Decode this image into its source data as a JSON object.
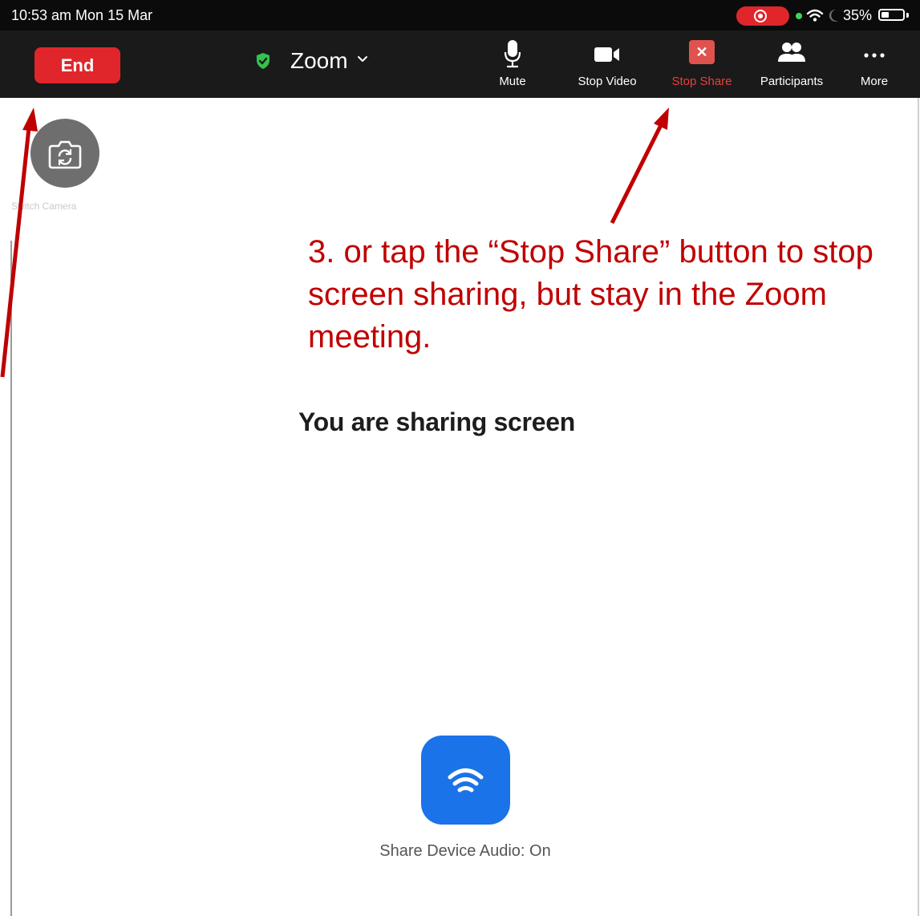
{
  "status_bar": {
    "time": "10:53 am  Mon 15 Mar",
    "battery": "35%",
    "icons": [
      "screen-record-icon",
      "camera-in-use-dot",
      "wifi-icon",
      "moon-icon",
      "battery-icon"
    ]
  },
  "toolbar": {
    "end_label": "End",
    "meeting_title": "Zoom",
    "buttons": [
      {
        "label": "Mute",
        "icon": "microphone-icon"
      },
      {
        "label": "Stop Video",
        "icon": "video-camera-icon"
      },
      {
        "label": "Stop Share",
        "icon": "stop-share-icon",
        "color": "#e6413a"
      },
      {
        "label": "Participants",
        "icon": "participants-icon"
      },
      {
        "label": "More",
        "icon": "more-dots-icon"
      }
    ]
  },
  "main": {
    "switch_camera_label": "Switch Camera",
    "annotation": "3. or tap the “Stop Share” button to stop screen sharing, but stay in the Zoom meeting.",
    "sharing_title": "You are sharing screen",
    "audio_label": "Share Device Audio: On"
  },
  "colors": {
    "end_button": "#e0262b",
    "annotation_text": "#c00000",
    "audio_button": "#1a73e8",
    "toolbar_bg": "#1a1a1a"
  }
}
